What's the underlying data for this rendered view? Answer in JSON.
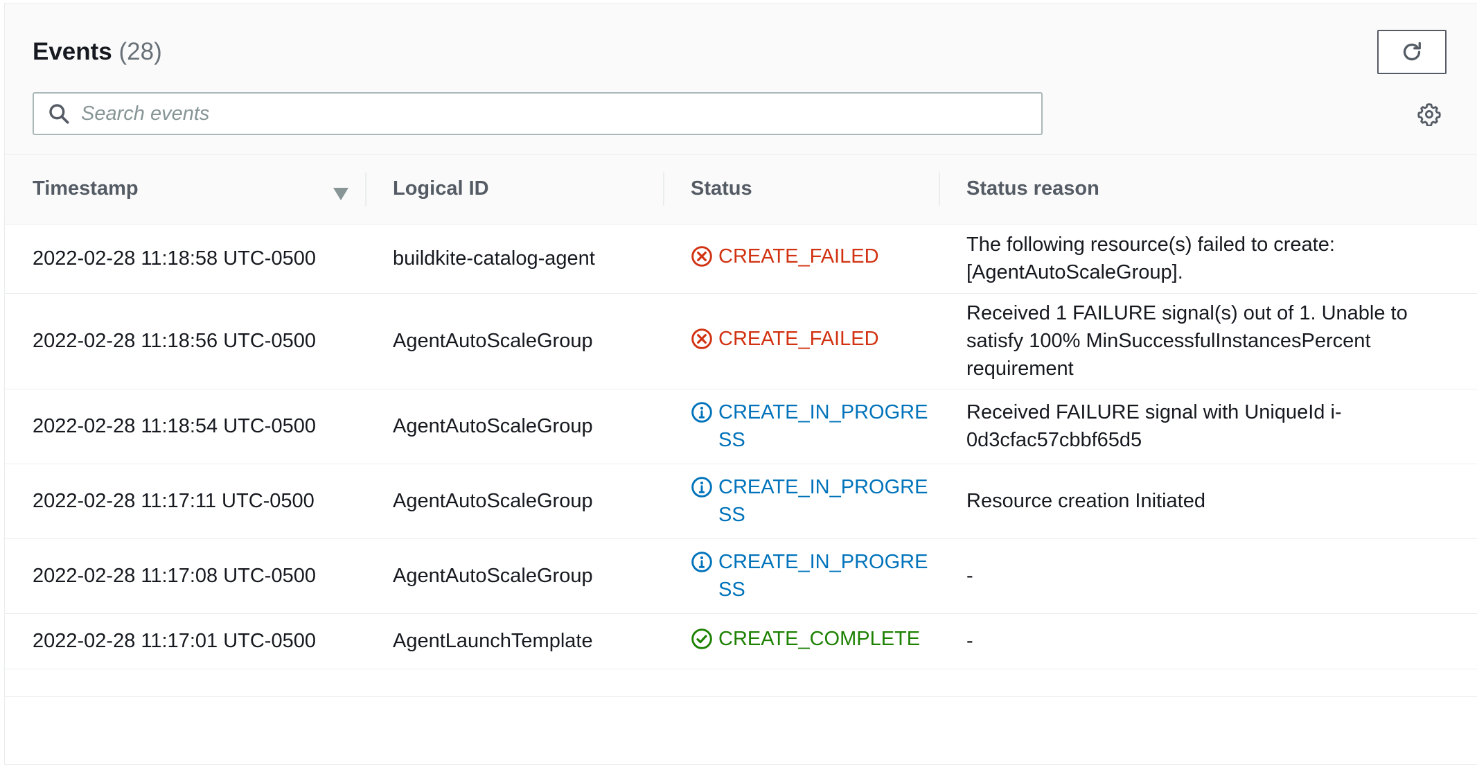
{
  "header": {
    "title": "Events",
    "count": "(28)",
    "refresh_icon": "refresh-icon",
    "settings_icon": "gear-icon"
  },
  "search": {
    "placeholder": "Search events",
    "value": ""
  },
  "table": {
    "columns": [
      "Timestamp",
      "Logical ID",
      "Status",
      "Status reason"
    ],
    "rows": [
      {
        "timestamp": "2022-02-28 11:18:58 UTC-0500",
        "logical_id": "buildkite-catalog-agent",
        "status": "CREATE_FAILED",
        "status_type": "failed",
        "reason": "The following resource(s) failed to create: [AgentAutoScaleGroup]."
      },
      {
        "timestamp": "2022-02-28 11:18:56 UTC-0500",
        "logical_id": "AgentAutoScaleGroup",
        "status": "CREATE_FAILED",
        "status_type": "failed",
        "reason": "Received 1 FAILURE signal(s) out of 1. Unable to satisfy 100% MinSuccessfulInstancesPercent requirement"
      },
      {
        "timestamp": "2022-02-28 11:18:54 UTC-0500",
        "logical_id": "AgentAutoScaleGroup",
        "status": "CREATE_IN_PROGRESS",
        "status_type": "progress",
        "reason": "Received FAILURE signal with UniqueId i-0d3cfac57cbbf65d5"
      },
      {
        "timestamp": "2022-02-28 11:17:11 UTC-0500",
        "logical_id": "AgentAutoScaleGroup",
        "status": "CREATE_IN_PROGRESS",
        "status_type": "progress",
        "reason": "Resource creation Initiated"
      },
      {
        "timestamp": "2022-02-28 11:17:08 UTC-0500",
        "logical_id": "AgentAutoScaleGroup",
        "status": "CREATE_IN_PROGRESS",
        "status_type": "progress",
        "reason": "-"
      },
      {
        "timestamp": "2022-02-28 11:17:01 UTC-0500",
        "logical_id": "AgentLaunchTemplate",
        "status": "CREATE_COMPLETE",
        "status_type": "complete",
        "reason": "-"
      }
    ]
  },
  "colors": {
    "failed": "#d13212",
    "progress": "#0073bb",
    "complete": "#1d8102"
  }
}
